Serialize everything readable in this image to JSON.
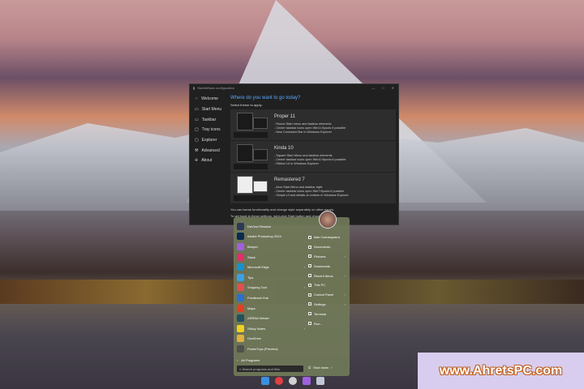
{
  "window": {
    "title": "StartAllBack configuration",
    "controls": [
      "—",
      "□",
      "✕"
    ],
    "sidebar": [
      {
        "label": "Welcome",
        "icon": "welcome-icon",
        "glyph": "⁘"
      },
      {
        "label": "Start Menu",
        "icon": "start-menu-icon",
        "glyph": "▭"
      },
      {
        "label": "Taskbar",
        "icon": "taskbar-icon",
        "glyph": "▭"
      },
      {
        "label": "Tray icons",
        "icon": "tray-icon",
        "glyph": "▢"
      },
      {
        "label": "Explorer",
        "icon": "explorer-icon",
        "glyph": "▢"
      },
      {
        "label": "Advanced",
        "icon": "wrench-icon",
        "glyph": "⚒"
      },
      {
        "label": "About",
        "icon": "about-icon",
        "glyph": "✢"
      }
    ],
    "heading": "Where do you want to go today?",
    "subheading": "Select theme to apply:",
    "themes": [
      {
        "title": "Proper 11",
        "lines": [
          "- Round Start menu and taskbar elements",
          "- Center taskbar icons open Win11 flyouts if possible",
          "- New Command Bar in Windows Explorer"
        ]
      },
      {
        "title": "Kinda 10",
        "lines": [
          "- Square Start Menu and taskbar elements",
          "- Center taskbar icons open Win10 flyouts if possible",
          "- Ribbon UI in Windows Explorer"
        ]
      },
      {
        "title": "Remastered 7",
        "lines": [
          "- Aero Start Menu and taskbar style",
          "- Center taskbar icons open Win7 flyouts if possible",
          "- Simple UI and details on bottom in Windows Explorer"
        ]
      }
    ],
    "footer": [
      "You can tweak functionality and change style separately on other pages.",
      "To get back to these settings, right-click Start button and choose ..."
    ]
  },
  "start_menu": {
    "apps": [
      {
        "label": "DaVinci Resolve",
        "color": "#2a3a5a"
      },
      {
        "label": "Adobe Photoshop 2024",
        "color": "#0a2a50"
      },
      {
        "label": "Beeper",
        "color": "#a060e0"
      },
      {
        "label": "Slack",
        "color": "#e0306a"
      },
      {
        "label": "Microsoft Edge",
        "color": "#1a90d0",
        "arrow": true
      },
      {
        "label": "Tips",
        "color": "#3aa0e8"
      },
      {
        "label": "Snipping Tool",
        "color": "#e05050",
        "arrow": true
      },
      {
        "label": "Feedback Hub",
        "color": "#2a70d0"
      },
      {
        "label": "Maps",
        "color": "#e04020"
      },
      {
        "label": "ASRNA Viewer",
        "color": "#205060"
      },
      {
        "label": "Sticky Notes",
        "color": "#f0d020",
        "arrow": true
      },
      {
        "label": "OneDrive",
        "color": "#e0b040"
      },
      {
        "label": "PowerToys (Preview)",
        "color": "#505050"
      }
    ],
    "all_programs": "All Programs",
    "places": [
      {
        "label": "Italo Carrasqueira"
      },
      {
        "label": "Documents"
      },
      {
        "label": "Pictures",
        "arrow": true
      },
      {
        "label": "Downloads"
      },
      {
        "label": "Recent Items",
        "arrow": true
      },
      {
        "label": "This PC"
      },
      {
        "label": "Control Panel",
        "arrow": true
      },
      {
        "label": "Settings",
        "arrow": true
      },
      {
        "label": "Terminal"
      },
      {
        "label": "Run..."
      }
    ],
    "search_placeholder": "Search programs and files",
    "shutdown": "Shut down"
  },
  "watermark": "www.AhretsPC.com"
}
